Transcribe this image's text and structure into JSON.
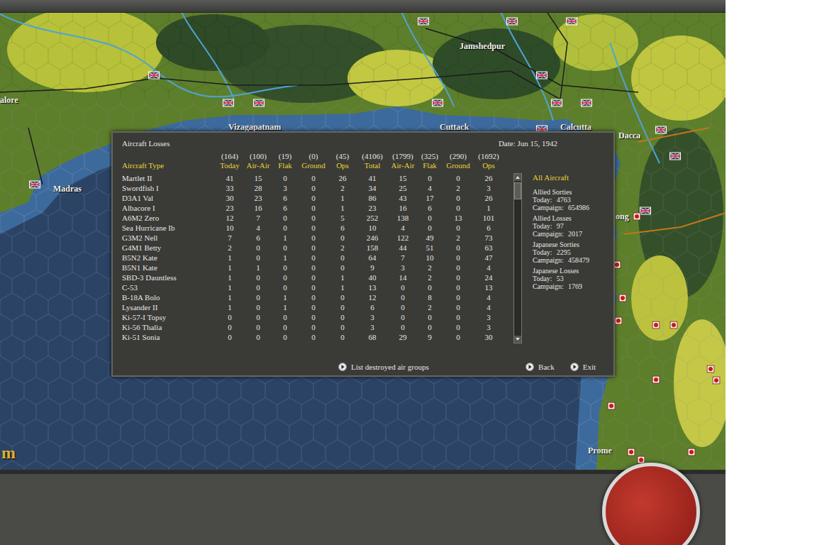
{
  "map": {
    "cities": [
      {
        "name": "alore"
      },
      {
        "name": "Madras"
      },
      {
        "name": "Vizagapatnam"
      },
      {
        "name": "Cuttack"
      },
      {
        "name": "Jamshedpur"
      },
      {
        "name": "Calcutta"
      },
      {
        "name": "Dacca"
      },
      {
        "name": "ong"
      },
      {
        "name": "Prome"
      }
    ],
    "corner_label": "m",
    "markers": [
      {
        "side": "allied"
      },
      {
        "side": "allied"
      },
      {
        "side": "allied"
      },
      {
        "side": "allied"
      },
      {
        "side": "allied"
      },
      {
        "side": "allied"
      },
      {
        "side": "allied"
      },
      {
        "side": "allied"
      },
      {
        "side": "allied"
      },
      {
        "side": "allied"
      },
      {
        "side": "allied"
      },
      {
        "side": "allied"
      },
      {
        "side": "allied"
      },
      {
        "side": "allied"
      },
      {
        "side": "allied"
      },
      {
        "side": "japanese"
      },
      {
        "side": "japanese"
      },
      {
        "side": "japanese"
      },
      {
        "side": "japanese"
      },
      {
        "side": "japanese"
      },
      {
        "side": "japanese"
      },
      {
        "side": "japanese"
      },
      {
        "side": "japanese"
      },
      {
        "side": "japanese"
      },
      {
        "side": "japanese"
      },
      {
        "side": "japanese"
      },
      {
        "side": "japanese"
      },
      {
        "side": "japanese"
      }
    ]
  },
  "dialog": {
    "title": "Aircraft Losses",
    "date": "Date: Jun 15, 1942",
    "columns": [
      {
        "total": "",
        "label": "Aircraft Type"
      },
      {
        "total": "(164)",
        "label": "Today"
      },
      {
        "total": "(100)",
        "label": "Air-Air"
      },
      {
        "total": "(19)",
        "label": "Flak"
      },
      {
        "total": "(0)",
        "label": "Ground"
      },
      {
        "total": "(45)",
        "label": "Ops"
      },
      {
        "total": "(4106)",
        "label": "Total"
      },
      {
        "total": "(1799)",
        "label": "Air-Air"
      },
      {
        "total": "(325)",
        "label": "Flak"
      },
      {
        "total": "(290)",
        "label": "Ground"
      },
      {
        "total": "(1692)",
        "label": "Ops"
      }
    ],
    "rows": [
      {
        "type": "Martlet II",
        "values": [
          "41",
          "15",
          "0",
          "0",
          "26",
          "41",
          "15",
          "0",
          "0",
          "26"
        ]
      },
      {
        "type": "Swordfish I",
        "values": [
          "33",
          "28",
          "3",
          "0",
          "2",
          "34",
          "25",
          "4",
          "2",
          "3"
        ]
      },
      {
        "type": "D3A1 Val",
        "values": [
          "30",
          "23",
          "6",
          "0",
          "1",
          "86",
          "43",
          "17",
          "0",
          "26"
        ]
      },
      {
        "type": "Albacore I",
        "values": [
          "23",
          "16",
          "6",
          "0",
          "1",
          "23",
          "16",
          "6",
          "0",
          "1"
        ]
      },
      {
        "type": "A6M2 Zero",
        "values": [
          "12",
          "7",
          "0",
          "0",
          "5",
          "252",
          "138",
          "0",
          "13",
          "101"
        ]
      },
      {
        "type": "Sea Hurricane Ib",
        "values": [
          "10",
          "4",
          "0",
          "0",
          "6",
          "10",
          "4",
          "0",
          "0",
          "6"
        ]
      },
      {
        "type": "G3M2 Nell",
        "values": [
          "7",
          "6",
          "1",
          "0",
          "0",
          "246",
          "122",
          "49",
          "2",
          "73"
        ]
      },
      {
        "type": "G4M1 Betty",
        "values": [
          "2",
          "0",
          "0",
          "0",
          "2",
          "158",
          "44",
          "51",
          "0",
          "63"
        ]
      },
      {
        "type": "B5N2 Kate",
        "values": [
          "1",
          "0",
          "1",
          "0",
          "0",
          "64",
          "7",
          "10",
          "0",
          "47"
        ]
      },
      {
        "type": "B5N1 Kate",
        "values": [
          "1",
          "1",
          "0",
          "0",
          "0",
          "9",
          "3",
          "2",
          "0",
          "4"
        ]
      },
      {
        "type": "SBD-3 Dauntless",
        "values": [
          "1",
          "0",
          "0",
          "0",
          "1",
          "40",
          "14",
          "2",
          "0",
          "24"
        ]
      },
      {
        "type": "C-53",
        "values": [
          "1",
          "0",
          "0",
          "0",
          "1",
          "13",
          "0",
          "0",
          "0",
          "13"
        ]
      },
      {
        "type": "B-18A Bolo",
        "values": [
          "1",
          "0",
          "1",
          "0",
          "0",
          "12",
          "0",
          "8",
          "0",
          "4"
        ]
      },
      {
        "type": "Lysander II",
        "values": [
          "1",
          "0",
          "1",
          "0",
          "0",
          "6",
          "0",
          "2",
          "0",
          "4"
        ]
      },
      {
        "type": "Ki-57-I Topsy",
        "values": [
          "0",
          "0",
          "0",
          "0",
          "0",
          "3",
          "0",
          "0",
          "0",
          "3"
        ]
      },
      {
        "type": "Ki-56 Thalia",
        "values": [
          "0",
          "0",
          "0",
          "0",
          "0",
          "3",
          "0",
          "0",
          "0",
          "3"
        ]
      },
      {
        "type": "Ki-51 Sonia",
        "values": [
          "0",
          "0",
          "0",
          "0",
          "0",
          "68",
          "29",
          "9",
          "0",
          "30"
        ]
      }
    ],
    "scrollbar": {
      "level": 0
    },
    "summary": {
      "title": "All Aircraft",
      "groups": [
        {
          "title": "Allied Sorties",
          "lines": [
            {
              "label": "Today:",
              "value": "4763"
            },
            {
              "label": "Campaign:",
              "value": "654986"
            }
          ]
        },
        {
          "title": "Allied Losses",
          "lines": [
            {
              "label": "Today:",
              "value": "97"
            },
            {
              "label": "Campaign:",
              "value": "2017"
            }
          ]
        },
        {
          "title": "Japanese Sorties",
          "lines": [
            {
              "label": "Today:",
              "value": "2295"
            },
            {
              "label": "Campaign:",
              "value": "458479"
            }
          ]
        },
        {
          "title": "Japanese Losses",
          "lines": [
            {
              "label": "Today:",
              "value": "53"
            },
            {
              "label": "Campaign:",
              "value": "1769"
            }
          ]
        }
      ]
    },
    "buttons": [
      {
        "label": "List destroyed air groups"
      },
      {
        "label": "Back"
      },
      {
        "label": "Exit"
      }
    ]
  }
}
